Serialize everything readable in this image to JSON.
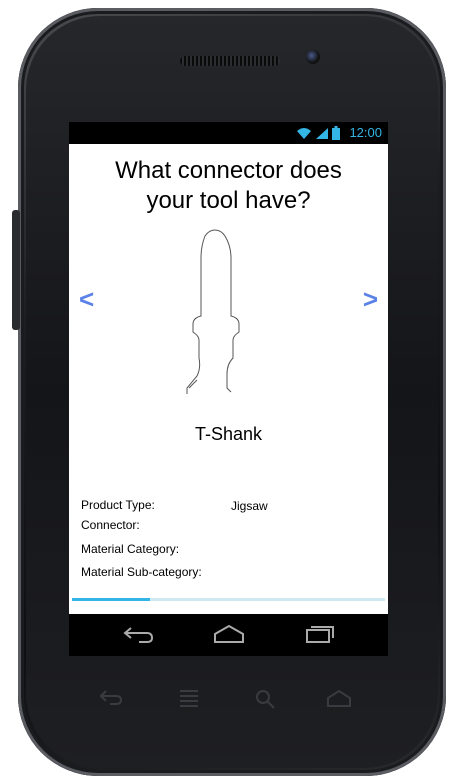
{
  "status_bar": {
    "time": "12:00"
  },
  "question": {
    "line1": "What connector does",
    "line2": "your tool have?"
  },
  "nav": {
    "prev": "<",
    "next": ">"
  },
  "connector": {
    "name": "T-Shank"
  },
  "info": {
    "product_type_label": "Product Type:",
    "product_type_value": "Jigsaw",
    "connector_label": "Connector:",
    "material_category_label": "Material Category:",
    "material_subcategory_label": "Material Sub-category:"
  },
  "progress": {
    "fraction": 0.25
  },
  "colors": {
    "accent": "#33b5e5",
    "nav_arrow": "#5b82e6"
  }
}
